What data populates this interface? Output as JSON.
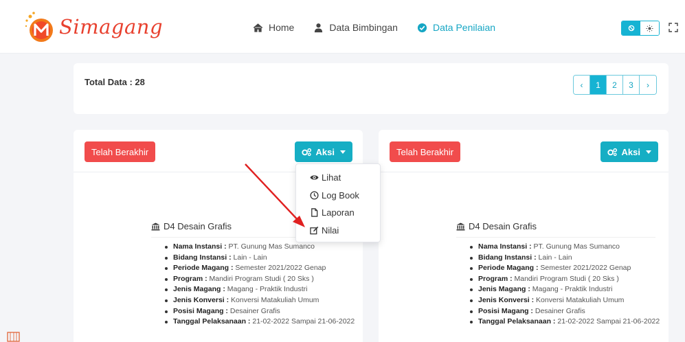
{
  "app": {
    "logo_text": "Simagang"
  },
  "nav": {
    "items": [
      {
        "label": "Home",
        "icon": "home-icon"
      },
      {
        "label": "Data Bimbingan",
        "icon": "user-icon"
      },
      {
        "label": "Data Penilaian",
        "icon": "check-circle-icon",
        "active": true
      }
    ]
  },
  "summary": {
    "total_label": "Total Data : 28",
    "pages": [
      "‹",
      "1",
      "2",
      "3",
      "›"
    ],
    "active_page": "1"
  },
  "cards": [
    {
      "status": "Telah Berakhir",
      "action_label": "Aksi",
      "prodi": "D4 Desain Grafis",
      "details": [
        {
          "key": "Nama Instansi :",
          "value": " PT. Gunung Mas Sumanco"
        },
        {
          "key": "Bidang Instansi :",
          "value": " Lain - Lain"
        },
        {
          "key": "Periode Magang :",
          "value": " Semester 2021/2022 Genap"
        },
        {
          "key": "Program :",
          "value": " Mandiri Program Studi ( 20 Sks )"
        },
        {
          "key": "Jenis Magang :",
          "value": " Magang - Praktik Industri"
        },
        {
          "key": "Jenis Konversi :",
          "value": " Konversi Matakuliah Umum"
        },
        {
          "key": "Posisi Magang :",
          "value": " Desainer Grafis"
        },
        {
          "key": "Tanggal Pelaksanaan :",
          "value": " 21-02-2022 Sampai 21-06-2022"
        }
      ]
    },
    {
      "status": "Telah Berakhir",
      "action_label": "Aksi",
      "prodi": "D4 Desain Grafis",
      "details": [
        {
          "key": "Nama Instansi :",
          "value": " PT. Gunung Mas Sumanco"
        },
        {
          "key": "Bidang Instansi :",
          "value": " Lain - Lain"
        },
        {
          "key": "Periode Magang :",
          "value": " Semester 2021/2022 Genap"
        },
        {
          "key": "Program :",
          "value": " Mandiri Program Studi ( 20 Sks )"
        },
        {
          "key": "Jenis Magang :",
          "value": " Magang - Praktik Industri"
        },
        {
          "key": "Jenis Konversi :",
          "value": " Konversi Matakuliah Umum"
        },
        {
          "key": "Posisi Magang :",
          "value": " Desainer Grafis"
        },
        {
          "key": "Tanggal Pelaksanaan :",
          "value": " 21-02-2022 Sampai 21-06-2022"
        }
      ]
    }
  ],
  "dropdown": {
    "items": [
      {
        "label": "Lihat",
        "icon": "eye-icon"
      },
      {
        "label": "Log Book",
        "icon": "clock-icon"
      },
      {
        "label": "Laporan",
        "icon": "file-icon"
      },
      {
        "label": "Nilai",
        "icon": "edit-icon"
      }
    ]
  },
  "colors": {
    "accent": "#16b3d3",
    "danger": "#f14c4c",
    "brand": "#e8412f",
    "annotation_arrow": "#e02020"
  }
}
